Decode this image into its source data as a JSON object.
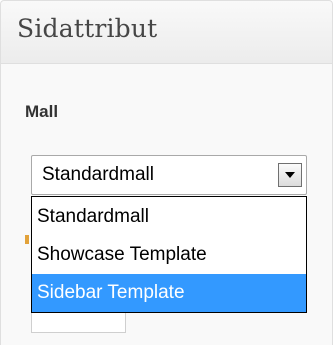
{
  "panel": {
    "title": "Sidattribut"
  },
  "template_field": {
    "label": "Mall",
    "selected_value": "Standardmall",
    "options": [
      {
        "label": "Standardmall"
      },
      {
        "label": "Showcase Template"
      },
      {
        "label": "Sidebar Template",
        "highlighted": true
      }
    ]
  },
  "colors": {
    "highlight": "#3399ff",
    "title_text": "#464646"
  }
}
